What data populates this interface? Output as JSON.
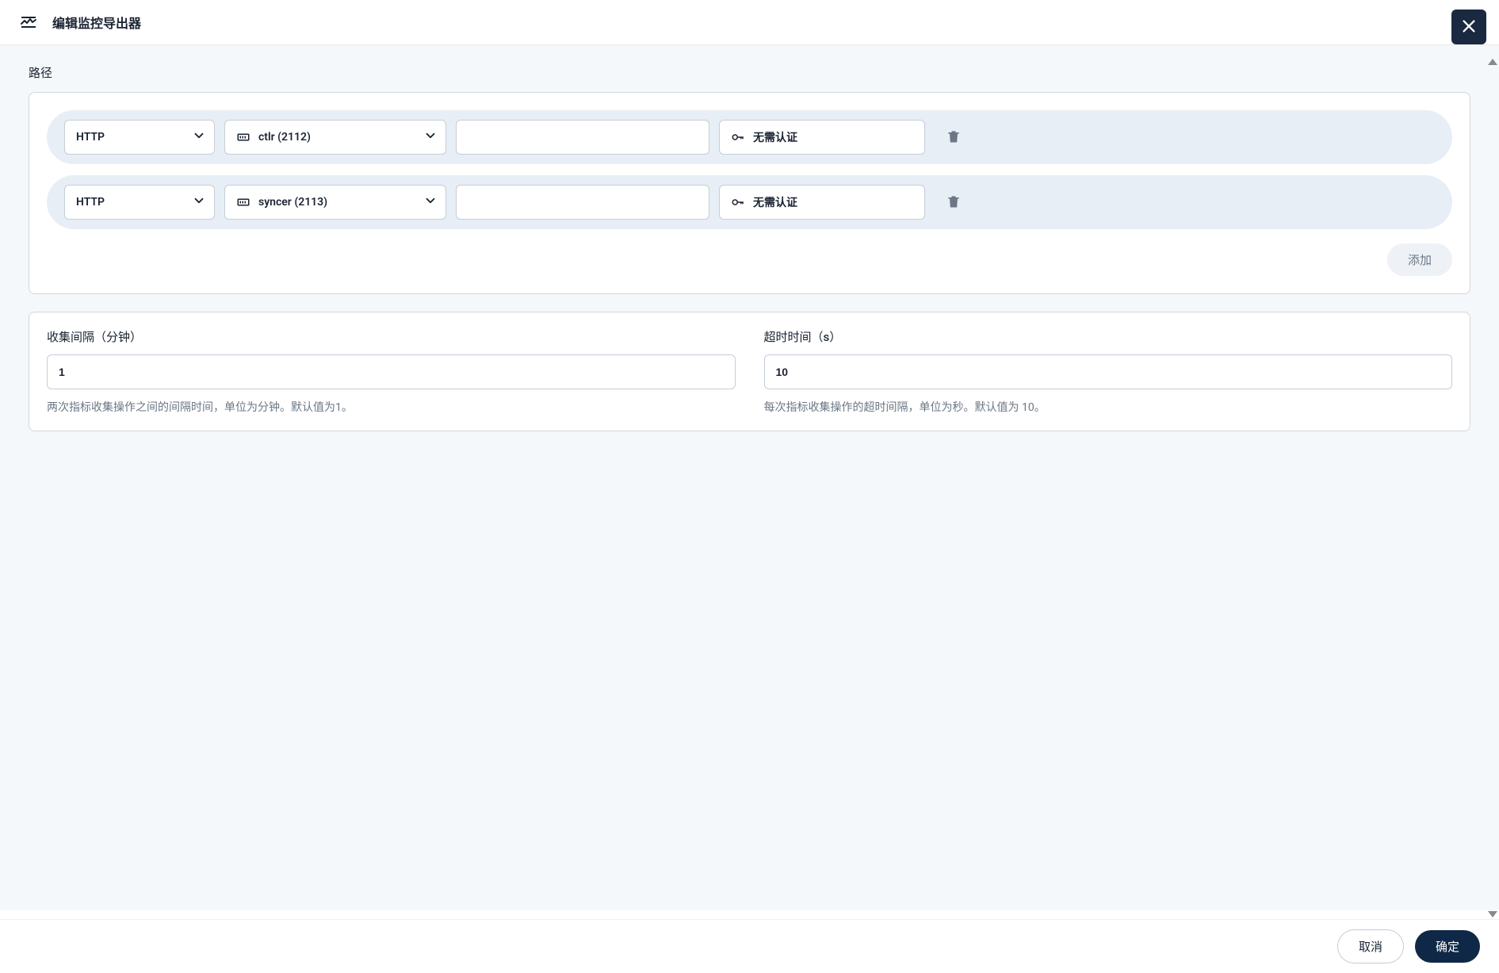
{
  "header": {
    "title": "编辑监控导出器"
  },
  "paths": {
    "label": "路径",
    "rows": [
      {
        "protocol": "HTTP",
        "port": "ctlr (2112)",
        "path": "",
        "auth": "无需认证"
      },
      {
        "protocol": "HTTP",
        "port": "syncer (2113)",
        "path": "",
        "auth": "无需认证"
      }
    ],
    "add_label": "添加"
  },
  "settings": {
    "interval": {
      "label": "收集间隔（分钟）",
      "value": "1",
      "help": "两次指标收集操作之间的间隔时间，单位为分钟。默认值为1。"
    },
    "timeout": {
      "label": "超时时间（s）",
      "value": "10",
      "help": "每次指标收集操作的超时间隔，单位为秒。默认值为 10。"
    }
  },
  "footer": {
    "cancel": "取消",
    "confirm": "确定"
  }
}
